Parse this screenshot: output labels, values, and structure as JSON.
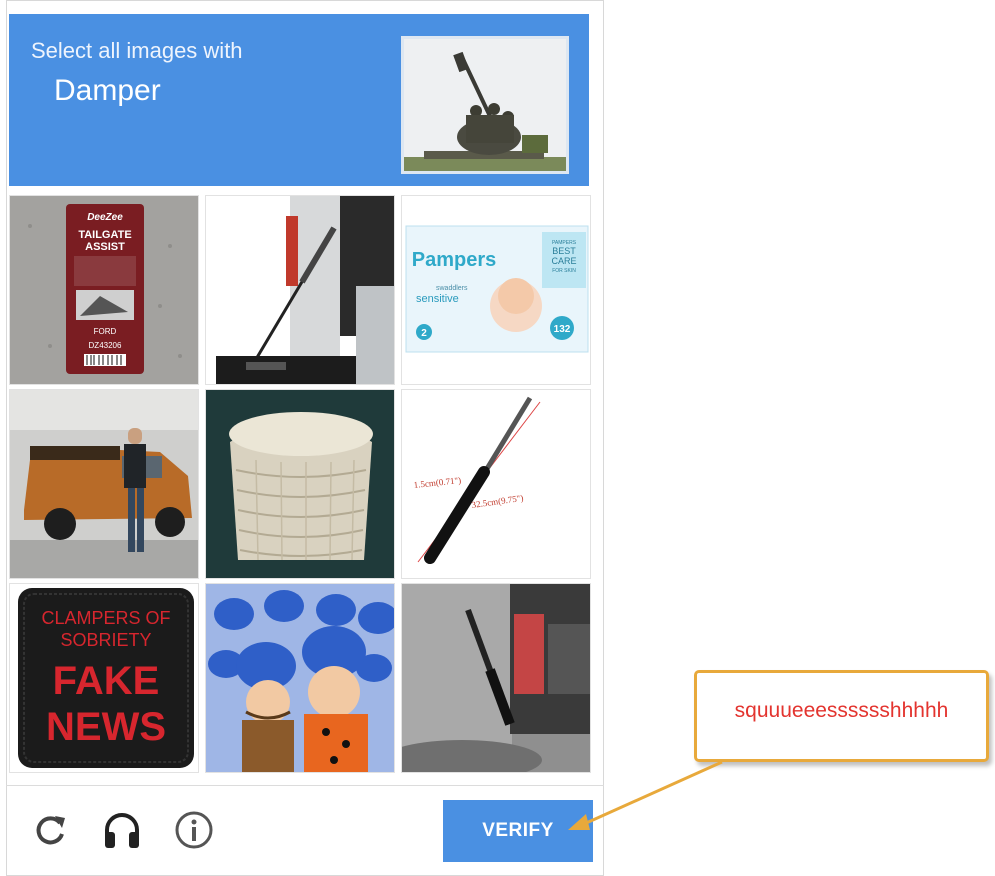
{
  "header": {
    "instruction": "Select all images with",
    "target": "Damper"
  },
  "tiles": [
    {
      "name": "tile-tailgate-assist-box",
      "label_line1": "TAILGATE",
      "label_line2": "ASSIST",
      "brand": "DeeZee",
      "make": "FORD",
      "part": "DZ43206"
    },
    {
      "name": "tile-tailgate-strut-open"
    },
    {
      "name": "tile-pampers-box",
      "brand": "Pampers",
      "sub": "swaddlers",
      "variant": "sensitive",
      "badge_line1": "PAMPERS",
      "badge_line2": "BEST",
      "badge_line3": "CARE",
      "badge_line4": "FOR SKIN",
      "count": "132",
      "size": "2"
    },
    {
      "name": "tile-orange-pickup-truck"
    },
    {
      "name": "tile-wicker-basket"
    },
    {
      "name": "tile-gas-strut-diagram",
      "dim1": "1.5cm(0.71\")",
      "dim2": "32.5cm(9.75\")"
    },
    {
      "name": "tile-fake-news-patch",
      "line1": "CLAMPERS OF",
      "line2": "SOBRIETY",
      "line3": "FAKE",
      "line4": "NEWS"
    },
    {
      "name": "tile-cartoon-lodge-crowd"
    },
    {
      "name": "tile-tailgate-strut-grayscale"
    }
  ],
  "footer": {
    "verify_label": "VERIFY",
    "icons": [
      "refresh-icon",
      "headphones-icon",
      "info-icon"
    ]
  },
  "callout": {
    "text": "squuueeesssssshhhhh"
  },
  "colors": {
    "accent": "#4a90e2",
    "callout_border": "#e8a93b",
    "callout_text": "#e3342f"
  }
}
